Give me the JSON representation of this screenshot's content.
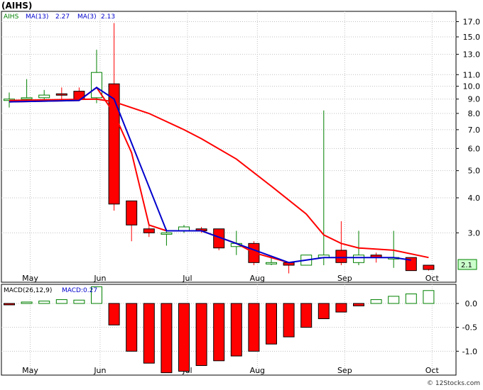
{
  "header": {
    "ticker": "(AIHS)",
    "legend_symbol": "AIHS",
    "ma13_label": "MA(13)",
    "ma13_value": "2.27",
    "ma3_label": "MA(3)",
    "ma3_value": "2.13"
  },
  "macd_legend": {
    "name": "MACD(26,12,9)",
    "value_label": "MACD:0.27"
  },
  "price_tag": "2.1",
  "footer": "© 12Stocks.com",
  "colors": {
    "up": "#008000",
    "down": "#ff0000",
    "ma_long": "#ff0000",
    "ma_short": "#0000cc",
    "grid": "#c0c0c0",
    "price_tag_bg": "#ccffcc"
  },
  "chart_data": [
    {
      "type": "candlestick",
      "scale": "log",
      "ylim": [
        2.0,
        18.5
      ],
      "y_ticks": [
        17.0,
        15.0,
        13.0,
        11.0,
        10.0,
        9.0,
        8.0,
        7.0,
        6.0,
        5.0,
        4.0,
        3.0
      ],
      "x_ticks": [
        "May",
        "Jun",
        "Jul",
        "Aug",
        "Sep",
        "Oct"
      ],
      "x_tick_index": [
        1.2,
        5.2,
        10.2,
        14.2,
        19.2,
        24.2
      ],
      "candles": [
        {
          "o": 8.9,
          "h": 9.5,
          "l": 8.4,
          "c": 9.0
        },
        {
          "o": 9.0,
          "h": 10.6,
          "l": 8.8,
          "c": 9.1
        },
        {
          "o": 9.1,
          "h": 9.7,
          "l": 8.9,
          "c": 9.3
        },
        {
          "o": 9.4,
          "h": 9.9,
          "l": 9.0,
          "c": 9.3
        },
        {
          "o": 9.6,
          "h": 9.9,
          "l": 8.9,
          "c": 9.0
        },
        {
          "o": 9.1,
          "h": 13.5,
          "l": 8.7,
          "c": 11.2
        },
        {
          "o": 10.2,
          "h": 16.8,
          "l": 3.6,
          "c": 3.8
        },
        {
          "o": 3.9,
          "h": 3.9,
          "l": 2.8,
          "c": 3.2
        },
        {
          "o": 3.1,
          "h": 3.2,
          "l": 2.9,
          "c": 3.0
        },
        {
          "o": 3.0,
          "h": 3.1,
          "l": 2.7,
          "c": 3.0
        },
        {
          "o": 3.05,
          "h": 3.2,
          "l": 3.0,
          "c": 3.15
        },
        {
          "o": 3.1,
          "h": 3.15,
          "l": 3.0,
          "c": 3.05
        },
        {
          "o": 3.1,
          "h": 3.1,
          "l": 2.6,
          "c": 2.65
        },
        {
          "o": 2.68,
          "h": 3.05,
          "l": 2.5,
          "c": 2.75
        },
        {
          "o": 2.75,
          "h": 2.8,
          "l": 2.3,
          "c": 2.35
        },
        {
          "o": 2.35,
          "h": 2.45,
          "l": 2.3,
          "c": 2.35
        },
        {
          "o": 2.35,
          "h": 2.35,
          "l": 2.15,
          "c": 2.3
        },
        {
          "o": 2.3,
          "h": 2.5,
          "l": 2.3,
          "c": 2.5
        },
        {
          "o": 2.45,
          "h": 8.2,
          "l": 2.3,
          "c": 2.5
        },
        {
          "o": 2.6,
          "h": 3.3,
          "l": 2.3,
          "c": 2.35
        },
        {
          "o": 2.35,
          "h": 3.05,
          "l": 2.3,
          "c": 2.5
        },
        {
          "o": 2.5,
          "h": 2.55,
          "l": 2.35,
          "c": 2.45
        },
        {
          "o": 2.42,
          "h": 3.05,
          "l": 2.25,
          "c": 2.45
        },
        {
          "o": 2.45,
          "h": 2.45,
          "l": 2.2,
          "c": 2.2
        },
        {
          "o": 2.3,
          "h": 2.3,
          "l": 2.2,
          "c": 2.22
        }
      ],
      "ma13": [
        [
          0,
          8.9
        ],
        [
          5,
          9.0
        ],
        [
          6,
          8.8
        ],
        [
          8,
          8.0
        ],
        [
          10,
          7.0
        ],
        [
          11,
          6.5
        ],
        [
          13,
          5.5
        ],
        [
          15,
          4.4
        ],
        [
          17,
          3.5
        ],
        [
          18,
          2.95
        ],
        [
          19,
          2.75
        ],
        [
          20,
          2.65
        ],
        [
          22,
          2.6
        ],
        [
          24,
          2.45
        ]
      ],
      "ma3": [
        [
          0,
          8.8
        ],
        [
          4,
          8.9
        ],
        [
          5,
          9.9
        ],
        [
          6,
          8.0
        ],
        [
          7,
          5.8
        ],
        [
          8,
          3.2
        ],
        [
          9,
          3.05
        ],
        [
          10,
          3.05
        ],
        [
          11,
          3.05
        ],
        [
          13,
          2.75
        ],
        [
          14,
          2.55
        ],
        [
          16,
          2.35
        ]
      ],
      "ma3_blue": [
        [
          0,
          8.8
        ],
        [
          4,
          8.9
        ],
        [
          5,
          9.9
        ],
        [
          6,
          9.0
        ],
        [
          9,
          3.05
        ],
        [
          11,
          3.05
        ],
        [
          16,
          2.35
        ],
        [
          18,
          2.45
        ],
        [
          22,
          2.45
        ],
        [
          23,
          2.4
        ]
      ]
    },
    {
      "type": "bar",
      "name": "MACD(26,12,9)",
      "ylim": [
        -1.5,
        0.4
      ],
      "y_ticks": [
        0.0,
        -0.5,
        -1.0
      ],
      "x_ticks": [
        "May",
        "Jun",
        "Jul",
        "Aug",
        "Sep",
        "Oct"
      ],
      "values": [
        -0.02,
        0.03,
        0.05,
        0.08,
        0.07,
        0.35,
        -0.45,
        -1.0,
        -1.25,
        -1.45,
        -1.42,
        -1.3,
        -1.2,
        -1.1,
        -1.0,
        -0.85,
        -0.7,
        -0.5,
        -0.32,
        -0.18,
        -0.05,
        0.08,
        0.15,
        0.2,
        0.27
      ]
    }
  ]
}
